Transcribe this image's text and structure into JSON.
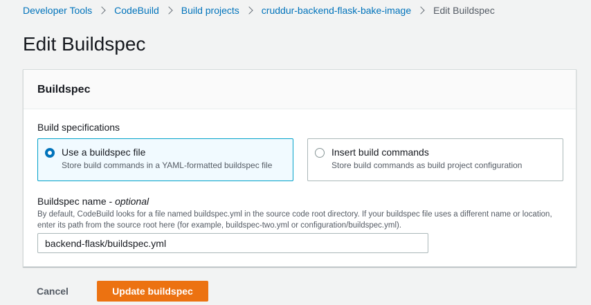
{
  "breadcrumb": {
    "items": [
      "Developer Tools",
      "CodeBuild",
      "Build projects",
      "cruddur-backend-flask-bake-image"
    ],
    "current": "Edit Buildspec"
  },
  "page": {
    "title": "Edit Buildspec"
  },
  "panel": {
    "title": "Buildspec",
    "build_spec_label": "Build specifications",
    "options": [
      {
        "title": "Use a buildspec file",
        "description": "Store build commands in a YAML-formatted buildspec file",
        "selected": true
      },
      {
        "title": "Insert build commands",
        "description": "Store build commands as build project configuration",
        "selected": false
      }
    ],
    "name_label": "Buildspec name",
    "name_optional": "optional",
    "name_help": "By default, CodeBuild looks for a file named buildspec.yml in the source code root directory. If your buildspec file uses a different name or location, enter its path from the source root here (for example, buildspec-two.yml or configuration/buildspec.yml).",
    "name_value": "backend-flask/buildspec.yml"
  },
  "actions": {
    "cancel_label": "Cancel",
    "submit_label": "Update buildspec"
  },
  "colors": {
    "link": "#0073bb",
    "primary": "#ec7211",
    "selected_border": "#00a1c9"
  }
}
